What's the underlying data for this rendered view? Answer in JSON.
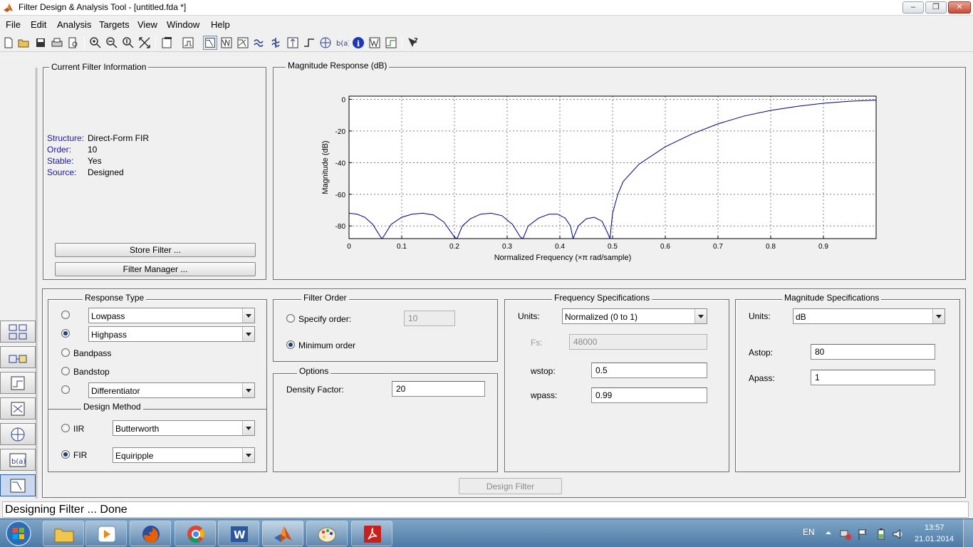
{
  "window": {
    "title": "Filter Design & Analysis Tool -  [untitled.fda *]"
  },
  "menu": [
    "File",
    "Edit",
    "Analysis",
    "Targets",
    "View",
    "Window",
    "Help"
  ],
  "toolbar_icons": [
    "new-file-icon",
    "open-file-icon",
    "save-icon",
    "print-icon",
    "print-preview-icon",
    "zoom-in-icon",
    "zoom-x-icon",
    "zoom-y-icon",
    "full-view-icon",
    "new-figure-icon",
    "full-view-analysis-icon",
    "magnitude-response-icon",
    "phase-response-icon",
    "magnitude-phase-icon",
    "group-delay-icon",
    "phase-delay-icon",
    "impulse-response-icon",
    "step-response-icon",
    "pole-zero-icon",
    "coefficients-icon",
    "filter-info-icon",
    "round-off-noise-icon",
    "magnitude-estimate-icon",
    "whats-this-icon"
  ],
  "filter_info": {
    "title": "Current Filter Information",
    "rows": [
      {
        "key": "Structure:",
        "value": "Direct-Form FIR"
      },
      {
        "key": "Order:",
        "value": "10"
      },
      {
        "key": "Stable:",
        "value": "Yes"
      },
      {
        "key": "Source:",
        "value": "Designed"
      }
    ],
    "store_button": "Store Filter ...",
    "manager_button": "Filter Manager ..."
  },
  "chart_data": {
    "type": "line",
    "title": "Magnitude Response (dB)",
    "xlabel": "Normalized Frequency  (×π rad/sample)",
    "ylabel": "Magnitude (dB)",
    "xlim": [
      0,
      1
    ],
    "ylim": [
      -88,
      2
    ],
    "xticks": [
      "0",
      "0.1",
      "0.2",
      "0.3",
      "0.4",
      "0.5",
      "0.6",
      "0.7",
      "0.8",
      "0.9"
    ],
    "yticks": [
      "0",
      "-20",
      "-40",
      "-60",
      "-80"
    ],
    "grid": true,
    "color": "#000080",
    "series": [
      {
        "x": [
          0,
          0.015,
          0.03,
          0.045,
          0.06,
          0.063,
          0.08,
          0.1,
          0.12,
          0.14,
          0.16,
          0.18,
          0.2,
          0.205,
          0.215,
          0.23,
          0.25,
          0.27,
          0.29,
          0.31,
          0.325,
          0.33,
          0.34,
          0.36,
          0.38,
          0.395,
          0.41,
          0.42,
          0.425,
          0.435,
          0.45,
          0.465,
          0.48,
          0.49,
          0.495,
          0.5,
          0.51,
          0.52,
          0.55,
          0.6,
          0.65,
          0.7,
          0.75,
          0.8,
          0.85,
          0.9,
          0.95,
          1.0
        ],
        "y": [
          -72,
          -72.5,
          -74.5,
          -79,
          -87,
          -88,
          -79,
          -74.5,
          -72.5,
          -72,
          -73,
          -77.5,
          -87,
          -88,
          -80,
          -75.5,
          -72.5,
          -72,
          -73.5,
          -79,
          -87,
          -88,
          -80,
          -75,
          -72.5,
          -72.5,
          -75,
          -80,
          -88,
          -80,
          -75.5,
          -74.5,
          -77,
          -84,
          -88,
          -72,
          -60,
          -52,
          -41,
          -30,
          -22,
          -15.5,
          -10.5,
          -7,
          -4.5,
          -2.5,
          -1.2,
          -0.5
        ]
      }
    ]
  },
  "response_type": {
    "title": "Response Type",
    "lowpass": "Lowpass",
    "highpass": "Highpass",
    "bandpass": "Bandpass",
    "bandstop": "Bandstop",
    "differentiator": "Differentiator"
  },
  "design_method": {
    "title": "Design Method",
    "iir_label": "IIR",
    "iir_value": "Butterworth",
    "fir_label": "FIR",
    "fir_value": "Equiripple"
  },
  "filter_order": {
    "title": "Filter Order",
    "specify_label": "Specify order:",
    "specify_value": "10",
    "minimum_label": "Minimum order"
  },
  "options": {
    "title": "Options",
    "density_label": "Density Factor:",
    "density_value": "20"
  },
  "freq_specs": {
    "title": "Frequency Specifications",
    "units_label": "Units:",
    "units_value": "Normalized (0 to 1)",
    "fs_label": "Fs:",
    "fs_value": "48000",
    "wstop_label": "wstop:",
    "wstop_value": "0.5",
    "wpass_label": "wpass:",
    "wpass_value": "0.99"
  },
  "mag_specs": {
    "title": "Magnitude Specifications",
    "units_label": "Units:",
    "units_value": "dB",
    "astop_label": "Astop:",
    "astop_value": "80",
    "apass_label": "Apass:",
    "apass_value": "1"
  },
  "design_button": "Design Filter",
  "status": "Designing Filter ... Done",
  "taskbar": {
    "lang": "EN",
    "time": "13:57",
    "date": "21.01.2014"
  }
}
